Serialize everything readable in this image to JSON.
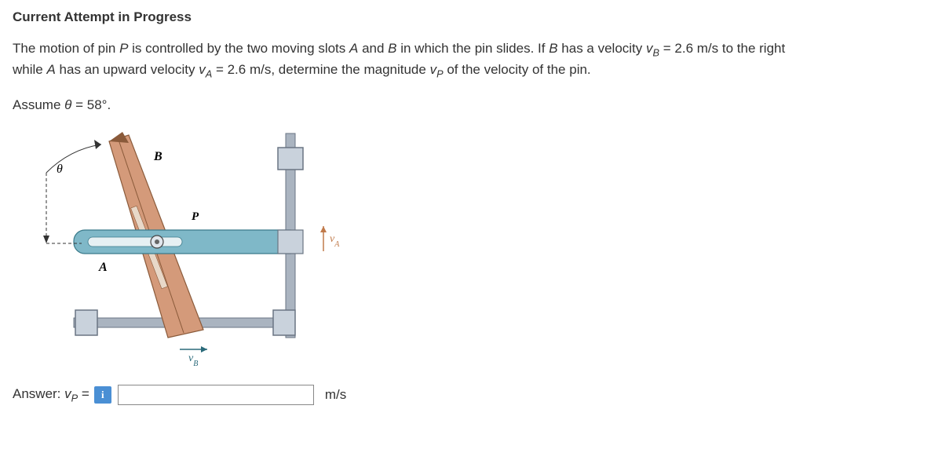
{
  "heading": "Current Attempt in Progress",
  "problem_line1": "The motion of pin P is controlled by the two moving slots A and B in which the pin slides. If B has a velocity vB = 2.6 m/s to the right",
  "problem_line2": "while A has an upward velocity vA = 2.6 m/s, determine the magnitude vP of the velocity of the pin.",
  "assume": "Assume θ = 58°.",
  "diagram": {
    "theta": "θ",
    "B": "B",
    "A": "A",
    "P": "P",
    "vA": "vA",
    "vB": "vB"
  },
  "answer": {
    "label_prefix": "Answer: ",
    "label_var": "vP",
    "label_eq": " = ",
    "unit": "m/s",
    "value": ""
  }
}
